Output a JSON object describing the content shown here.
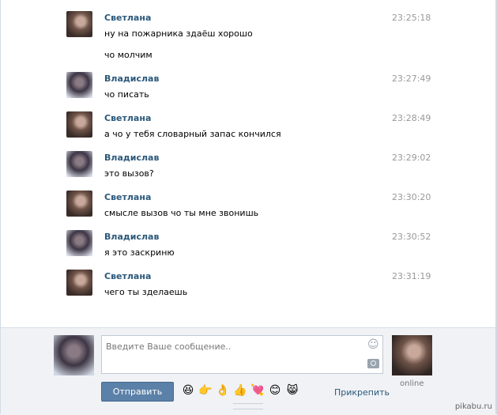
{
  "messages": [
    {
      "author": "Светлана",
      "time": "23:25:18",
      "lines": [
        "ну на пожарника здаёш хорошо",
        "чо молчим"
      ],
      "avatar": "svetlana-avatar"
    },
    {
      "author": "Владислав",
      "time": "23:27:49",
      "lines": [
        "чо писать"
      ],
      "avatar": "vladislav-avatar"
    },
    {
      "author": "Светлана",
      "time": "23:28:49",
      "lines": [
        "а чо у тебя словарный запас кончился"
      ],
      "avatar": "svetlana-avatar"
    },
    {
      "author": "Владислав",
      "time": "23:29:02",
      "lines": [
        "это вызов?"
      ],
      "avatar": "vladislav-avatar"
    },
    {
      "author": "Светлана",
      "time": "23:30:20",
      "lines": [
        "смысле вызов чо ты мне звонишь"
      ],
      "avatar": "svetlana-avatar"
    },
    {
      "author": "Владислав",
      "time": "23:30:52",
      "lines": [
        "я это заскриню"
      ],
      "avatar": "vladislav-avatar"
    },
    {
      "author": "Светлана",
      "time": "23:31:19",
      "lines": [
        "чего ты зделаешь"
      ],
      "avatar": "svetlana-avatar"
    }
  ],
  "composer": {
    "placeholder": "Введите Ваше сообщение..",
    "send_label": "Отправить",
    "attach_label": "Прикрепить",
    "partner_status": "online",
    "emojis": [
      "😆",
      "👉",
      "👌",
      "👍",
      "💘",
      "😊",
      "😸"
    ]
  },
  "watermark": "pikabu.ru",
  "colors": {
    "author": "#2b587a",
    "send_button": "#5b81a8",
    "composer_bg": "#f0f2f5"
  }
}
